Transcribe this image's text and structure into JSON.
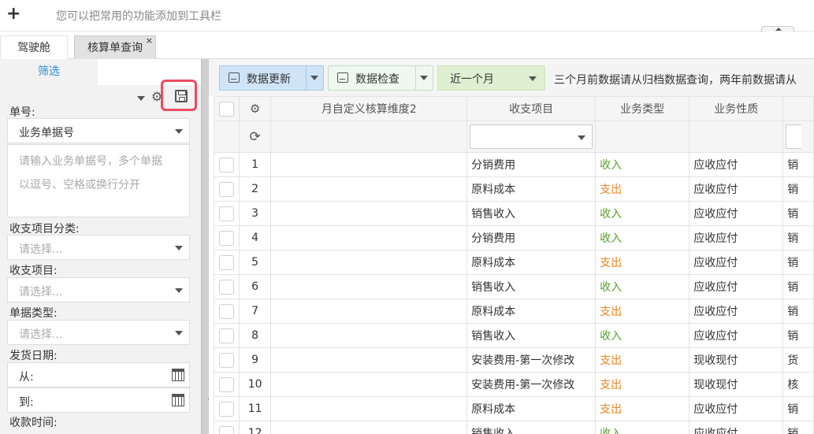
{
  "toolbar_hint": "您可以把常用的功能添加到工具栏",
  "tabs": [
    {
      "label": "驾驶舱"
    },
    {
      "label": "核算单查询",
      "close": "×"
    }
  ],
  "left_panel": {
    "tab_label": "筛选",
    "doc_no_label": "单号:",
    "doc_no_type": "业务单据号",
    "doc_no_placeholder_line1": "请输入业务单据号，多个单据",
    "doc_no_placeholder_line2": "以逗号、空格或换行分开",
    "category_label": "收支项目分类:",
    "category_placeholder": "请选择...",
    "item_label": "收支项目:",
    "item_placeholder": "请选择...",
    "doctype_label": "单据类型:",
    "doctype_placeholder": "请选择...",
    "ship_date_label": "发货日期:",
    "from_label": "从:",
    "to_label": "到:",
    "receipt_time_label": "收款时间:"
  },
  "toolbar": {
    "update_label": "数据更新",
    "check_label": "数据检查",
    "period_value": "近一个月",
    "notice": "三个月前数据请从归档数据查询，两年前数据请从"
  },
  "grid": {
    "columns": [
      "月自定义核算维度2",
      "收支项目",
      "业务类型",
      "业务性质"
    ],
    "rows": [
      {
        "no": "1",
        "item": "分销费用",
        "type": "收入",
        "nature": "应收应付",
        "extra": "销"
      },
      {
        "no": "2",
        "item": "原料成本",
        "type": "支出",
        "nature": "应收应付",
        "extra": "销"
      },
      {
        "no": "3",
        "item": "销售收入",
        "type": "收入",
        "nature": "应收应付",
        "extra": "销"
      },
      {
        "no": "4",
        "item": "分销费用",
        "type": "收入",
        "nature": "应收应付",
        "extra": "销"
      },
      {
        "no": "5",
        "item": "原料成本",
        "type": "支出",
        "nature": "应收应付",
        "extra": "销"
      },
      {
        "no": "6",
        "item": "销售收入",
        "type": "收入",
        "nature": "应收应付",
        "extra": "销"
      },
      {
        "no": "7",
        "item": "原料成本",
        "type": "支出",
        "nature": "应收应付",
        "extra": "销"
      },
      {
        "no": "8",
        "item": "销售收入",
        "type": "收入",
        "nature": "应收应付",
        "extra": "销"
      },
      {
        "no": "9",
        "item": "安装费用-第一次修改",
        "type": "支出",
        "nature": "现收现付",
        "extra": "货"
      },
      {
        "no": "10",
        "item": "安装费用-第一次修改",
        "type": "支出",
        "nature": "现收现付",
        "extra": "核"
      },
      {
        "no": "11",
        "item": "原料成本",
        "type": "支出",
        "nature": "应收应付",
        "extra": "销"
      },
      {
        "no": "12",
        "item": "销售收入",
        "type": "收入",
        "nature": "应收应付",
        "extra": "销"
      }
    ]
  },
  "colors": {
    "accent": "#2a8fd0",
    "income": "#5aa02c",
    "expense": "#e8861d",
    "highlight": "#ec4b62"
  }
}
